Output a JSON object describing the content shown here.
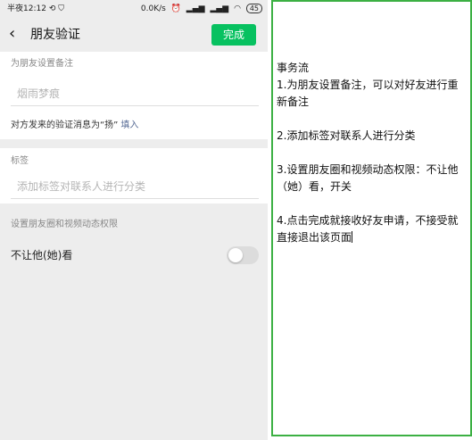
{
  "status_bar": {
    "time": "半夜12:12",
    "left_icons": [
      "sync-icon",
      "shield-icon"
    ],
    "network_speed": "0.0K/s",
    "right_icons": [
      "alarm-icon",
      "signal-icon",
      "signal-icon",
      "wifi-icon"
    ],
    "battery": "45"
  },
  "nav": {
    "back_icon": "chevron-left-icon",
    "title": "朋友验证",
    "done_label": "完成"
  },
  "remark": {
    "label": "为朋友设置备注",
    "placeholder": "烟雨梦痕",
    "verify_message": "对方发来的验证消息为“扬”",
    "fill_link": "填入"
  },
  "tags": {
    "label": "标签",
    "placeholder": "添加标签对联系人进行分类"
  },
  "permissions": {
    "label": "设置朋友圈和视频动态权限",
    "toggle_label": "不让他(她)看",
    "toggle_on": false
  },
  "note": {
    "lines": [
      "事务流",
      "1.为朋友设置备注，可以对好友进行重新备注",
      "",
      "2.添加标签对联系人进行分类",
      "",
      "3.设置朋友圈和视频动态权限：不让他（她）看，开关",
      "",
      "4.点击完成就接收好友申请，不接受就直接退出该页面"
    ]
  },
  "colors": {
    "accent_green": "#07c160",
    "link_blue": "#576b95",
    "panel_border": "#3cb043",
    "background_gray": "#ededed"
  }
}
